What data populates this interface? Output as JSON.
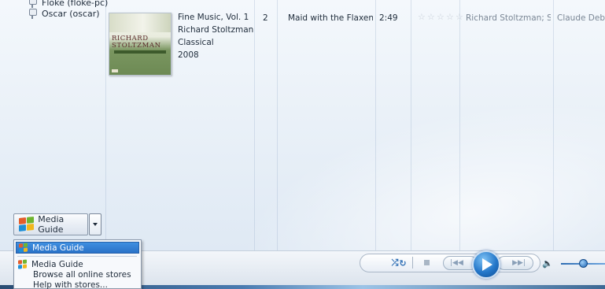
{
  "navigation": {
    "items": [
      {
        "label": "Floke (floke-pc)",
        "icon": "network-library-icon"
      },
      {
        "label": "Oscar (oscar)",
        "icon": "network-library-icon"
      }
    ]
  },
  "album": {
    "title": "Fine Music, Vol. 1",
    "artist": "Richard Stoltzman",
    "genre": "Classical",
    "year": "2008",
    "art_text_line1": "RICHARD",
    "art_text_line2": "STOLTZMAN"
  },
  "track": {
    "number": "2",
    "title": "Maid with the Flaxen Hair",
    "length": "2:49",
    "rating_stars": 0,
    "rating_max": 5,
    "contributing_artist": "Richard Stoltzman; Slov...",
    "composer": "Claude Debus"
  },
  "media_guide": {
    "button_label": "Media Guide",
    "menu": {
      "selected_item": "Media Guide",
      "items": [
        "Media Guide",
        "Browse all online stores",
        "Help with stores..."
      ]
    }
  },
  "player": {
    "controls": [
      "shuffle",
      "repeat",
      "stop",
      "previous",
      "play",
      "next",
      "mute",
      "volume"
    ],
    "volume_level": 0.45
  },
  "colors": {
    "accent": "#2a72c8",
    "play_button": "#2477c9",
    "library_bg": "#eaf1f8"
  }
}
